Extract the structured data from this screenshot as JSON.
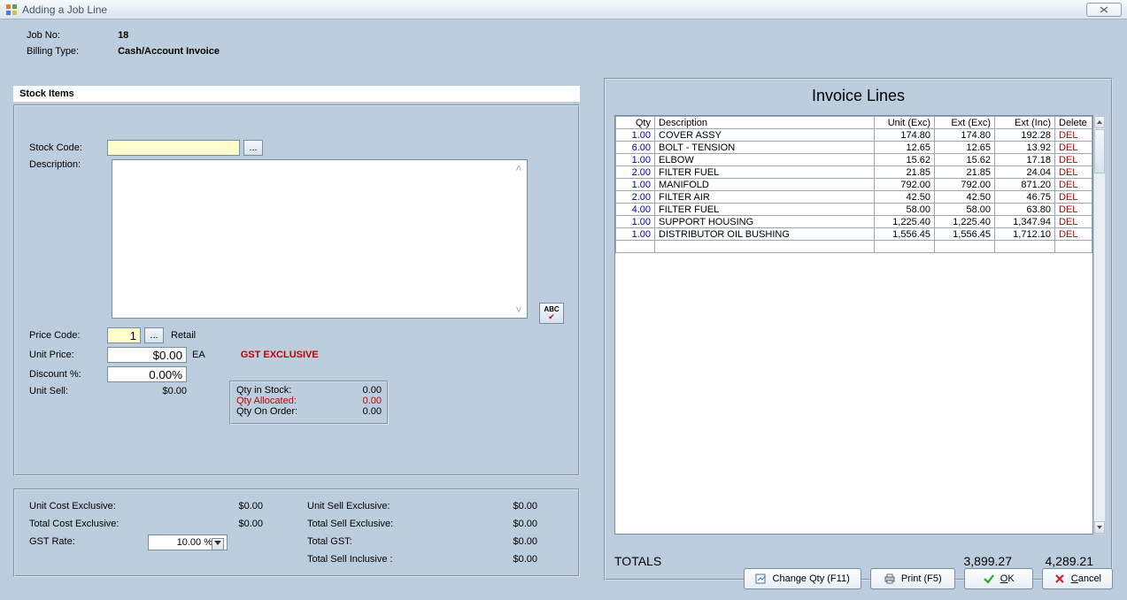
{
  "window": {
    "title": "Adding a Job Line"
  },
  "header": {
    "jobno_label": "Job No:",
    "jobno_value": "18",
    "billing_label": "Billing Type:",
    "billing_value": "Cash/Account Invoice"
  },
  "tabs": {
    "stock_items": "Stock Items"
  },
  "form": {
    "stock_code_label": "Stock Code:",
    "stock_code_value": "",
    "description_label": "Description:",
    "description_value": "",
    "price_code_label": "Price Code:",
    "price_code_value": "1",
    "price_code_text": "Retail",
    "unit_price_label": "Unit Price:",
    "unit_price_value": "$0.00",
    "unit_price_uom": "EA",
    "gst_exclusive": "GST EXCLUSIVE",
    "discount_label": "Discount %:",
    "discount_value": "0.00%",
    "unit_sell_label": "Unit Sell:",
    "unit_sell_value": "$0.00",
    "browse": "...",
    "qty_in_stock_label": "Qty in Stock:",
    "qty_in_stock_value": "0.00",
    "qty_allocated_label": "Qty Allocated:",
    "qty_allocated_value": "0.00",
    "qty_on_order_label": "Qty On Order:",
    "qty_on_order_value": "0.00"
  },
  "totals_panel": {
    "unit_cost_excl_label": "Unit Cost Exclusive:",
    "unit_cost_excl_value": "$0.00",
    "total_cost_excl_label": "Total Cost Exclusive:",
    "total_cost_excl_value": "$0.00",
    "gst_rate_label": "GST Rate:",
    "gst_rate_value": "10.00 %",
    "unit_sell_excl_label": "Unit Sell Exclusive:",
    "unit_sell_excl_value": "$0.00",
    "total_sell_excl_label": "Total Sell Exclusive:",
    "total_sell_excl_value": "$0.00",
    "total_gst_label": "Total GST:",
    "total_gst_value": "$0.00",
    "total_sell_incl_label": "Total Sell Inclusive :",
    "total_sell_incl_value": "$0.00"
  },
  "invoice": {
    "title": "Invoice Lines",
    "columns": {
      "qty": "Qty",
      "desc": "Description",
      "unit_exc": "Unit (Exc)",
      "ext_exc": "Ext (Exc)",
      "ext_inc": "Ext (Inc)",
      "del": "Delete"
    },
    "rows": [
      {
        "qty": "1.00",
        "desc": "COVER ASSY",
        "unit_exc": "174.80",
        "ext_exc": "174.80",
        "ext_inc": "192.28",
        "del": "DEL"
      },
      {
        "qty": "6.00",
        "desc": "BOLT - TENSION",
        "unit_exc": "12.65",
        "ext_exc": "12.65",
        "ext_inc": "13.92",
        "del": "DEL"
      },
      {
        "qty": "1.00",
        "desc": "ELBOW",
        "unit_exc": "15.62",
        "ext_exc": "15.62",
        "ext_inc": "17.18",
        "del": "DEL"
      },
      {
        "qty": "2.00",
        "desc": "FILTER FUEL",
        "unit_exc": "21.85",
        "ext_exc": "21.85",
        "ext_inc": "24.04",
        "del": "DEL"
      },
      {
        "qty": "1.00",
        "desc": "MANIFOLD",
        "unit_exc": "792.00",
        "ext_exc": "792.00",
        "ext_inc": "871.20",
        "del": "DEL"
      },
      {
        "qty": "2.00",
        "desc": "FILTER AIR",
        "unit_exc": "42.50",
        "ext_exc": "42.50",
        "ext_inc": "46.75",
        "del": "DEL"
      },
      {
        "qty": "4.00",
        "desc": "FILTER FUEL",
        "unit_exc": "58.00",
        "ext_exc": "58.00",
        "ext_inc": "63.80",
        "del": "DEL"
      },
      {
        "qty": "1.00",
        "desc": "SUPPORT HOUSING",
        "unit_exc": "1,225.40",
        "ext_exc": "1,225.40",
        "ext_inc": "1,347.94",
        "del": "DEL"
      },
      {
        "qty": "1.00",
        "desc": "DISTRIBUTOR OIL BUSHING",
        "unit_exc": "1,556.45",
        "ext_exc": "1,556.45",
        "ext_inc": "1,712.10",
        "del": "DEL"
      }
    ],
    "totals_label": "TOTALS",
    "totals_ext_exc": "3,899.27",
    "totals_ext_inc": "4,289.21"
  },
  "buttons": {
    "change_qty": "Change Qty (F11)",
    "print": "Print (F5)",
    "ok": "OK",
    "cancel": "Cancel"
  }
}
